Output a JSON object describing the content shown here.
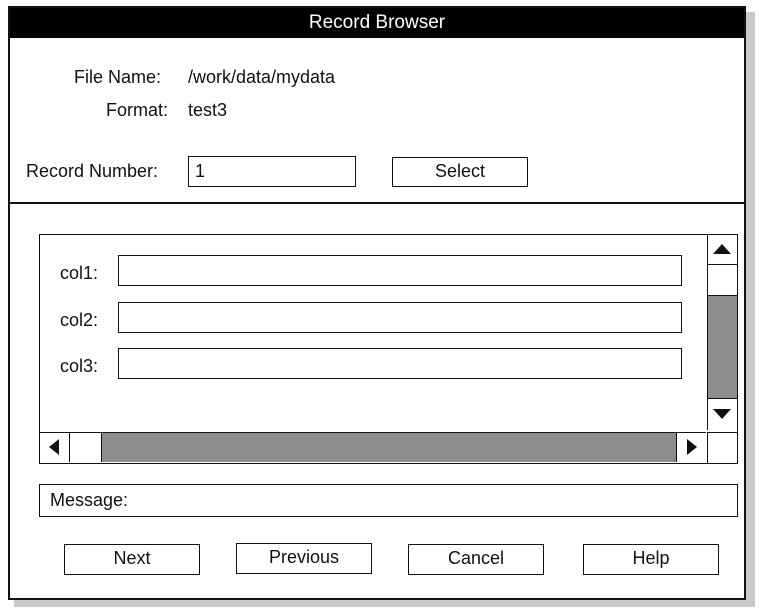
{
  "window": {
    "title": "Record Browser"
  },
  "file": {
    "name_label": "File Name:",
    "name_value": "/work/data/mydata",
    "format_label": "Format:",
    "format_value": "test3"
  },
  "record": {
    "label": "Record Number:",
    "value": "1",
    "select_label": "Select"
  },
  "fields": [
    {
      "label": "col1:",
      "value": ""
    },
    {
      "label": "col2:",
      "value": ""
    },
    {
      "label": "col3:",
      "value": ""
    }
  ],
  "message": {
    "label": "Message:"
  },
  "buttons": {
    "next": "Next",
    "previous": "Previous",
    "cancel": "Cancel",
    "help": "Help"
  },
  "colors": {
    "titlebar": "#000000",
    "scroll_track": "#8c8c8c",
    "shadow": "#c9c9c9"
  },
  "icons": [
    "up-arrow-icon",
    "down-arrow-icon",
    "left-arrow-icon",
    "right-arrow-icon"
  ]
}
